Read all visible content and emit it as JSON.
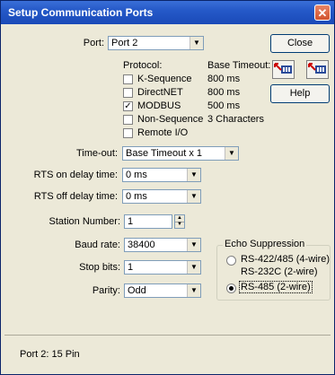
{
  "window": {
    "title": "Setup Communication Ports",
    "close_glyph": "✕"
  },
  "port": {
    "label": "Port:",
    "value": "Port 2"
  },
  "protocol": {
    "header": "Protocol:",
    "timeout_header": "Base Timeout:",
    "items": [
      {
        "name": "K-Sequence",
        "timeout": "800 ms",
        "checked": false
      },
      {
        "name": "DirectNET",
        "timeout": "800 ms",
        "checked": false
      },
      {
        "name": "MODBUS",
        "timeout": "500 ms",
        "checked": true
      },
      {
        "name": "Non-Sequence",
        "timeout": "3 Characters",
        "checked": false
      },
      {
        "name": "Remote I/O",
        "timeout": "",
        "checked": false
      }
    ]
  },
  "buttons": {
    "close": "Close",
    "help": "Help"
  },
  "timeout": {
    "label": "Time-out:",
    "value": "Base Timeout x 1"
  },
  "rts_on": {
    "label": "RTS on delay time:",
    "value": "0 ms"
  },
  "rts_off": {
    "label": "RTS off delay time:",
    "value": "0 ms"
  },
  "station": {
    "label": "Station Number:",
    "value": "1"
  },
  "baud": {
    "label": "Baud rate:",
    "value": "38400"
  },
  "stopbits": {
    "label": "Stop bits:",
    "value": "1"
  },
  "parity": {
    "label": "Parity:",
    "value": "Odd"
  },
  "echo": {
    "title": "Echo Suppression",
    "option1_line1": "RS-422/485 (4-wire)",
    "option1_line2": "RS-232C (2-wire)",
    "option2": "RS-485 (2-wire)",
    "selected": 2
  },
  "status": {
    "text": "Port 2:  15 Pin"
  },
  "icons": {
    "cable_icon_1": "cable-left-icon",
    "cable_icon_2": "cable-right-icon"
  }
}
